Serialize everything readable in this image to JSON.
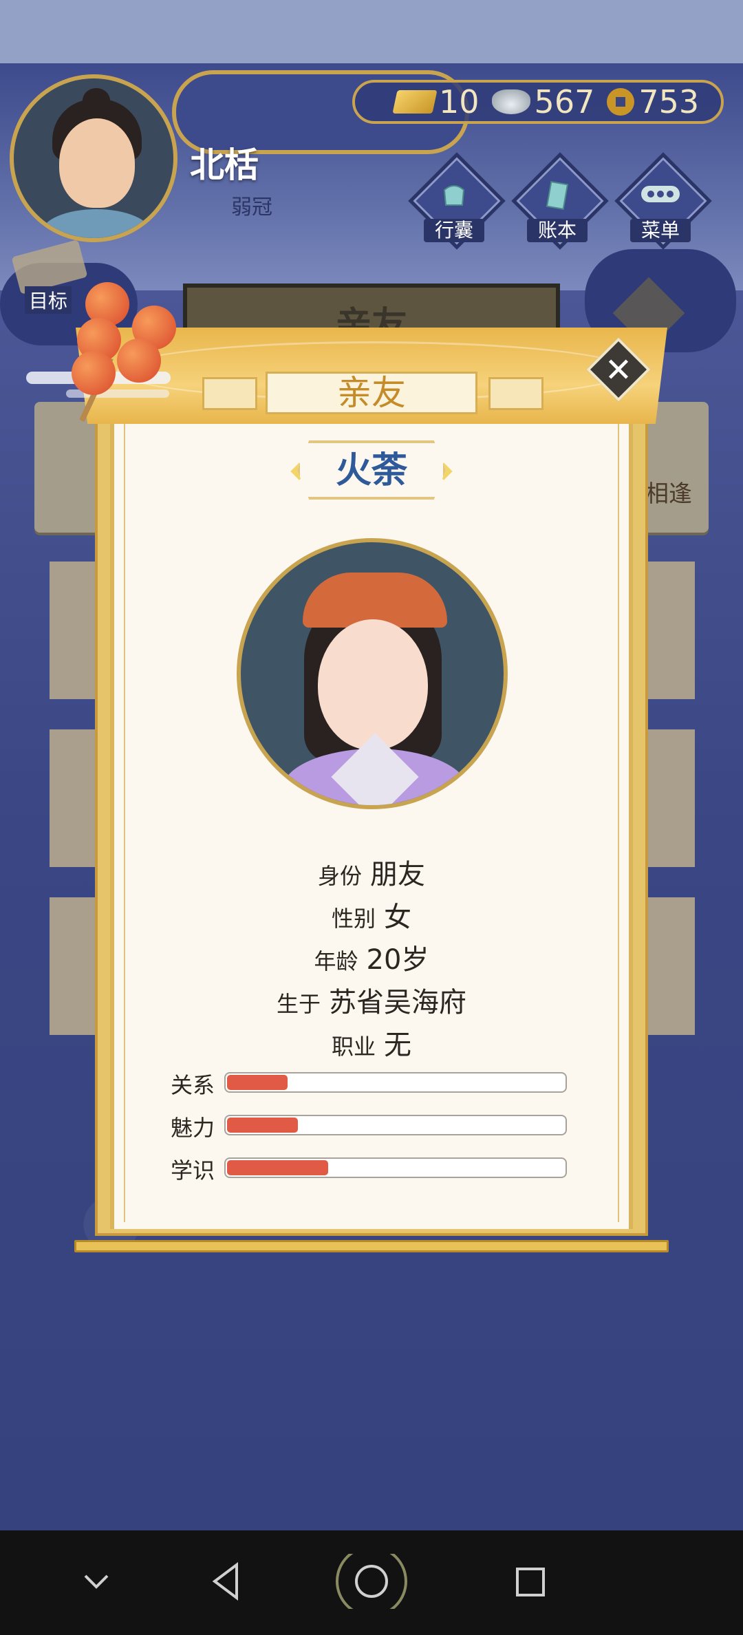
{
  "player": {
    "name": "北栝",
    "title": "弱冠"
  },
  "currency": {
    "gold": "10",
    "silver": "567",
    "coins": "753"
  },
  "menu": {
    "bag_label": "行囊",
    "ledger_label": "账本",
    "menu_label": "菜单",
    "goal_label": "目标"
  },
  "background": {
    "panel_title": "亲友",
    "card_text": "相逢"
  },
  "dialog": {
    "title": "亲友",
    "character_name": "火荼",
    "fields": [
      {
        "key": "身份",
        "value": "朋友"
      },
      {
        "key": "性别",
        "value": "女"
      },
      {
        "key": "年龄",
        "value": "20岁"
      },
      {
        "key": "生于",
        "value": "苏省吴海府"
      },
      {
        "key": "职业",
        "value": "无"
      }
    ],
    "stats": [
      {
        "label": "关系",
        "value": 0.18
      },
      {
        "label": "魅力",
        "value": 0.21
      },
      {
        "label": "学识",
        "value": 0.3
      }
    ]
  },
  "colors": {
    "accent_gold": "#c8a450",
    "stat_fill": "#e05a45",
    "name_blue": "#2e5a9a"
  },
  "icons": [
    "gold-ingot-icon",
    "silver-ingot-icon",
    "coin-icon",
    "bag-icon",
    "ledger-icon",
    "menu-dots-icon",
    "close-icon",
    "scroll-icon"
  ]
}
